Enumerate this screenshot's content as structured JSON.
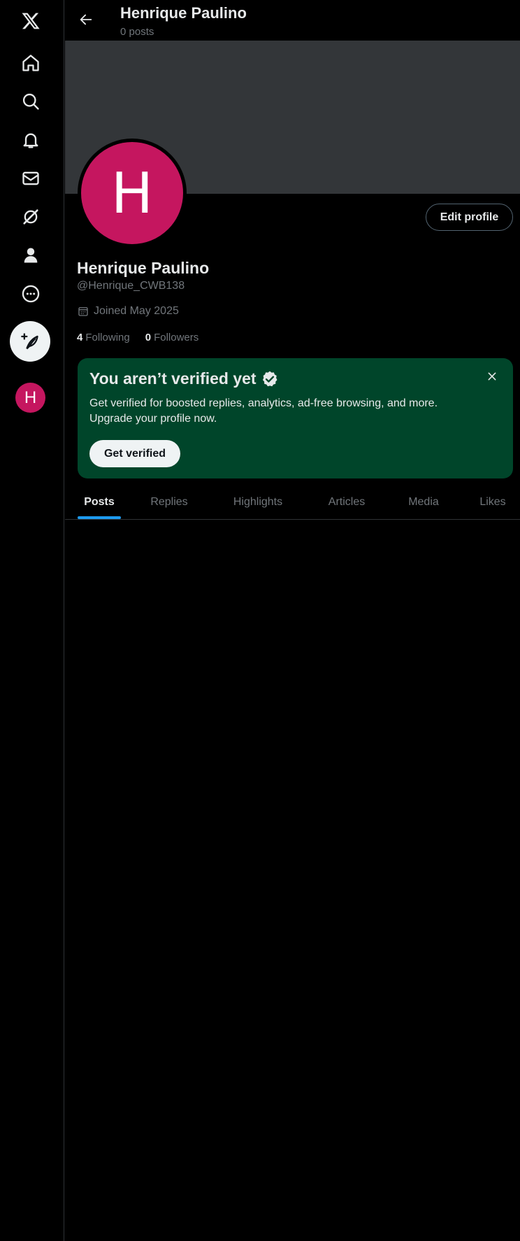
{
  "sidebar": {
    "items": [
      {
        "name": "x-logo-icon"
      },
      {
        "name": "home-icon"
      },
      {
        "name": "search-icon"
      },
      {
        "name": "notifications-icon"
      },
      {
        "name": "messages-icon"
      },
      {
        "name": "grok-icon"
      },
      {
        "name": "profile-icon"
      },
      {
        "name": "more-icon"
      }
    ],
    "compose_icon": "compose-post-icon",
    "avatar_letter": "H"
  },
  "header": {
    "title": "Henrique Paulino",
    "post_count": "0 posts"
  },
  "profile": {
    "avatar_letter": "H",
    "avatar_color": "#c5165f",
    "edit_label": "Edit profile",
    "name": "Henrique Paulino",
    "handle": "@Henrique_CWB138",
    "joined": "Joined May 2025",
    "following_count": "4",
    "following_label": "Following",
    "followers_count": "0",
    "followers_label": "Followers"
  },
  "verify": {
    "title": "You aren’t verified yet",
    "description": "Get verified for boosted replies, analytics, ad-free browsing, and more. Upgrade your profile now.",
    "button": "Get verified",
    "background_color": "#00452a"
  },
  "tabs": [
    {
      "label": "Posts",
      "active": true
    },
    {
      "label": "Replies",
      "active": false
    },
    {
      "label": "Highlights",
      "active": false
    },
    {
      "label": "Articles",
      "active": false
    },
    {
      "label": "Media",
      "active": false
    },
    {
      "label": "Likes",
      "active": false
    }
  ],
  "colors": {
    "accent": "#1d9bf0",
    "banner": "#333639"
  }
}
